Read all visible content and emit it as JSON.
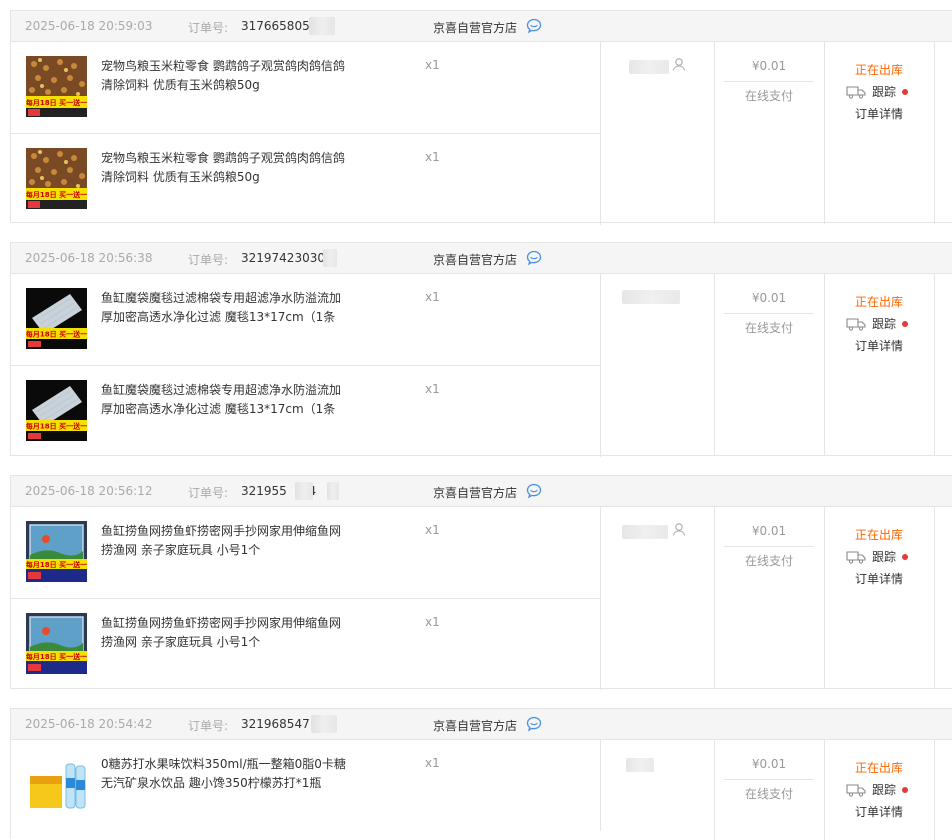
{
  "common": {
    "order_no_label": "订单号:",
    "shop": "京喜自营官方店",
    "amount": "¥0.01",
    "pay_type": "在线支付",
    "status": "正在出库",
    "track": "跟踪",
    "detail": "订单详情",
    "qty": "x1"
  },
  "orders": [
    {
      "date": "2025-06-18 20:59:03",
      "order_no": "317665805",
      "product": "宠物鸟粮玉米粒零食 鹦鹉鸽子观赏鸽肉鸽信鸽清除饲料 优质有玉米鸽粮50g",
      "thumb_text": "每月18日 买一送一"
    },
    {
      "date": "2025-06-18 20:56:38",
      "order_no": "32197423030",
      "product": "鱼缸魔袋魔毯过滤棉袋专用超滤净水防溢流加厚加密高透水净化过滤 魔毯13*17cm（1条",
      "thumb_text": "每月18日 买一送一"
    },
    {
      "date": "2025-06-18 20:56:12",
      "order_no": "321955",
      "order_no_tail": "94",
      "product": "鱼缸捞鱼网捞鱼虾捞密网手抄网家用伸缩鱼网捞渔网 亲子家庭玩具 小号1个",
      "thumb_text": "每月18日 买一送一"
    },
    {
      "date": "2025-06-18 20:54:42",
      "order_no": "321968547",
      "product": "0糖苏打水果味饮料350ml/瓶一整箱0脂0卡糖无汽矿泉水饮品 趣小馋350柠檬苏打*1瓶",
      "thumb_text": ""
    }
  ],
  "colors": {
    "status": "#ff6600",
    "dot": "#e4393c",
    "chat": "#4a90e2"
  }
}
